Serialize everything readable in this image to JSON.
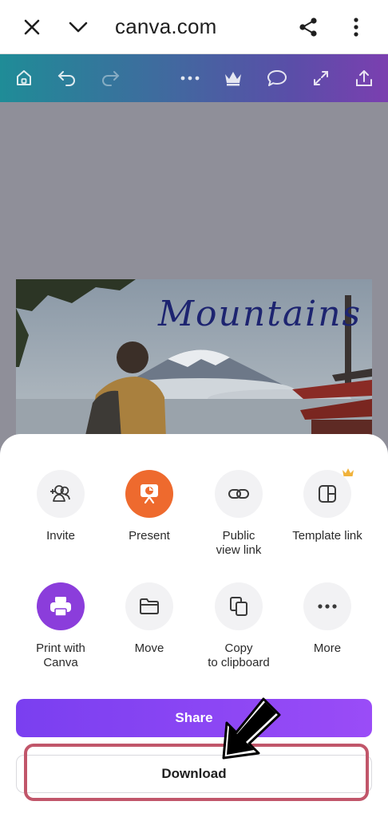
{
  "browser": {
    "url": "canva.com",
    "icons": [
      "close-icon",
      "chevron-down-icon",
      "share-icon",
      "more-vertical-icon"
    ]
  },
  "toolbar": {
    "icons": [
      "home-icon",
      "undo-icon",
      "redo-icon",
      "more-horizontal-icon",
      "crown-icon",
      "comment-icon",
      "expand-icon",
      "upload-icon"
    ]
  },
  "design": {
    "title_text": "Mountains"
  },
  "sheet": {
    "actions": [
      {
        "label": "Invite",
        "icon": "add-people-icon"
      },
      {
        "label": "Present",
        "icon": "present-icon",
        "color": "#ee6a2e"
      },
      {
        "label": "Public\nview link",
        "icon": "link-icon"
      },
      {
        "label": "Template link",
        "icon": "template-icon",
        "badge": "crown-icon"
      },
      {
        "label": "Print with\nCanva",
        "icon": "printer-icon",
        "color": "#8b3ddb"
      },
      {
        "label": "Move",
        "icon": "folder-icon"
      },
      {
        "label": "Copy\nto clipboard",
        "icon": "copy-icon"
      },
      {
        "label": "More",
        "icon": "more-horizontal-icon"
      }
    ],
    "share_label": "Share",
    "download_label": "Download"
  },
  "colors": {
    "share_gradient_start": "#7a3ff0",
    "share_gradient_end": "#9a4cf7",
    "highlight": "#c1566a"
  }
}
